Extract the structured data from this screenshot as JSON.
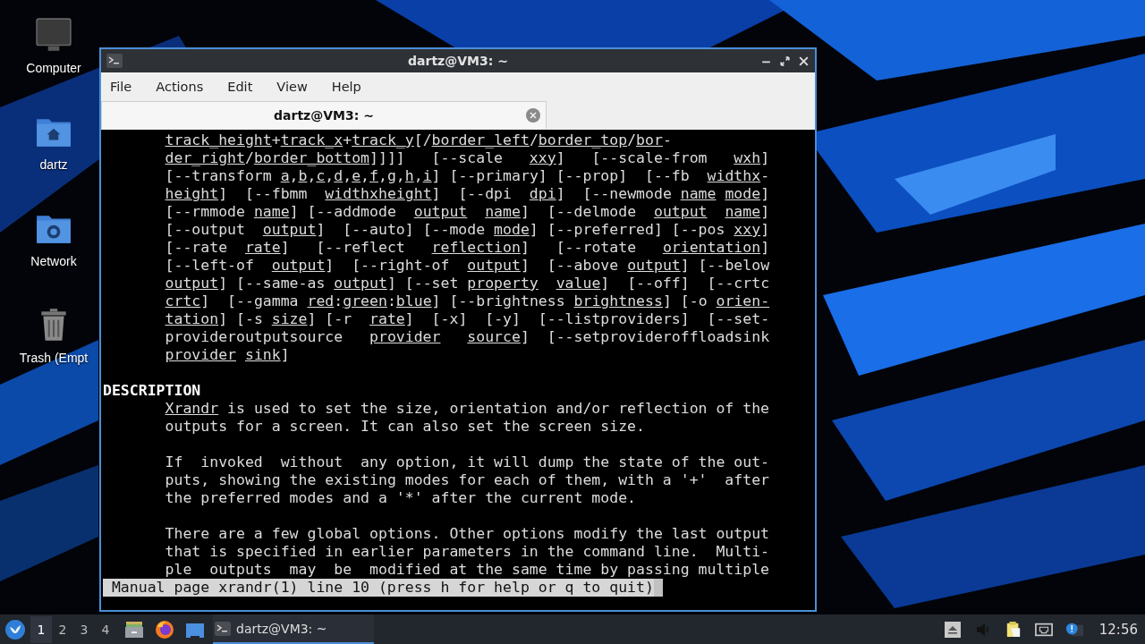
{
  "desktop_icons": [
    {
      "label": "Computer",
      "kind": "computer"
    },
    {
      "label": "dartz",
      "kind": "home"
    },
    {
      "label": "Network",
      "kind": "network"
    },
    {
      "label": "Trash (Empt",
      "kind": "trash"
    }
  ],
  "window": {
    "title": "dartz@VM3: ~",
    "menu": [
      "File",
      "Actions",
      "Edit",
      "View",
      "Help"
    ],
    "tabs": [
      {
        "label": "dartz@VM3: ~",
        "selected": true
      }
    ],
    "lines": [
      {
        "kind": "indented",
        "text": "*track_height*+*track_x*+*track_y*[/*border_left*/*border_top*/*bor*-"
      },
      {
        "kind": "indented",
        "text": "*der_right*/*border_bottom*]]]]   [--scale   *xxy*]   [--scale-from   *wxh*]"
      },
      {
        "kind": "indented",
        "text": "[--transform *a*,*b*,*c*,*d*,*e*,*f*,*g*,*h*,*i*] [--primary] [--prop]  [--fb  *widthx*-"
      },
      {
        "kind": "indented",
        "text": "*height*]  [--fbmm  *widthxheight*]  [--dpi  *dpi*]  [--newmode *name* *mode*]"
      },
      {
        "kind": "indented",
        "text": "[--rmmode *name*] [--addmode  *output*  *name*]  [--delmode  *output*  *name*]"
      },
      {
        "kind": "indented",
        "text": "[--output  *output*]  [--auto] [--mode *mode*] [--preferred] [--pos *xxy*]"
      },
      {
        "kind": "indented",
        "text": "[--rate  *rate*]   [--reflect   *reflection*]   [--rotate   *orientation*]"
      },
      {
        "kind": "indented",
        "text": "[--left-of  *output*]  [--right-of  *output*]  [--above *output*] [--below"
      },
      {
        "kind": "indented",
        "text": "*output*] [--same-as *output*] [--set *property*  *value*]  [--off]  [--crtc"
      },
      {
        "kind": "indented",
        "text": "*crtc*]  [--gamma *red*:*green*:*blue*] [--brightness *brightness*] [-o *orien-*"
      },
      {
        "kind": "indented",
        "text": "*tation*] [-s *size*] [-r  *rate*]  [-x]  [-y]  [--listproviders]  [--set-"
      },
      {
        "kind": "indented",
        "text": "provideroutputsource   *provider*   *source*]  [--setprovideroffloadsink"
      },
      {
        "kind": "indented",
        "text": "*provider* *sink*]"
      },
      {
        "kind": "blank"
      },
      {
        "kind": "heading",
        "text": "DESCRIPTION"
      },
      {
        "kind": "indented",
        "text": "*Xrandr* is used to set the size, orientation and/or reflection of the"
      },
      {
        "kind": "indented",
        "text": "outputs for a screen. It can also set the screen size."
      },
      {
        "kind": "blank"
      },
      {
        "kind": "indented",
        "text": "If  invoked  without  any option, it will dump the state of the out-"
      },
      {
        "kind": "indented",
        "text": "puts, showing the existing modes for each of them, with a '+'  after"
      },
      {
        "kind": "indented",
        "text": "the preferred modes and a '*' after the current mode."
      },
      {
        "kind": "blank"
      },
      {
        "kind": "indented",
        "text": "There are a few global options. Other options modify the last output"
      },
      {
        "kind": "indented",
        "text": "that is specified in earlier parameters in the command line.  Multi-"
      },
      {
        "kind": "indented",
        "text": "ple  outputs  may  be  modified at the same time by passing multiple"
      }
    ],
    "status": "Manual page xrandr(1) line 10 (press h for help or q to quit)"
  },
  "taskbar": {
    "workspaces": [
      {
        "label": "1",
        "selected": true
      },
      {
        "label": "2",
        "selected": false
      },
      {
        "label": "3",
        "selected": false
      },
      {
        "label": "4",
        "selected": false
      }
    ],
    "tasks": [
      {
        "label": "dartz@VM3: ~",
        "selected": true
      }
    ],
    "clock": "12:56"
  }
}
